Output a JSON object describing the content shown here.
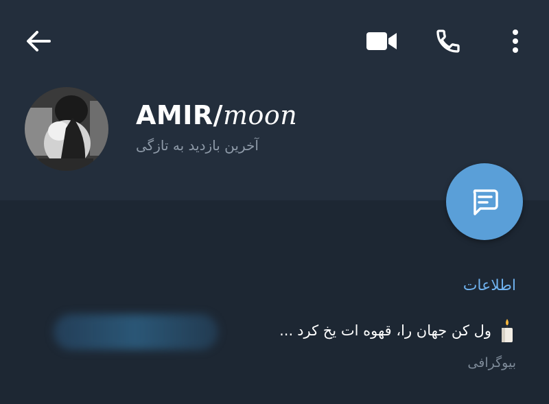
{
  "toolbar": {
    "back_icon": "arrow-left-icon",
    "video_icon": "video-camera-icon",
    "phone_icon": "phone-icon",
    "menu_icon": "more-vertical-icon"
  },
  "profile": {
    "name_part1": "AMIR/",
    "name_part2": "moon",
    "status": "آخرین بازدید به تازگی",
    "avatar_icon": "avatar-photo"
  },
  "fab": {
    "icon": "message-icon",
    "color": "#5a9fd8"
  },
  "info": {
    "title": "اطلاعات",
    "bio_text": "ول کن جهان را، قهوه ات یخ کرد",
    "bio_trailing": "...",
    "bio_emoji": "candle-icon",
    "bio_label": "بیوگرافی"
  },
  "colors": {
    "background": "#1d2733",
    "header": "#232e3c",
    "accent": "#6fb2ef",
    "muted": "#8e9aa8"
  }
}
